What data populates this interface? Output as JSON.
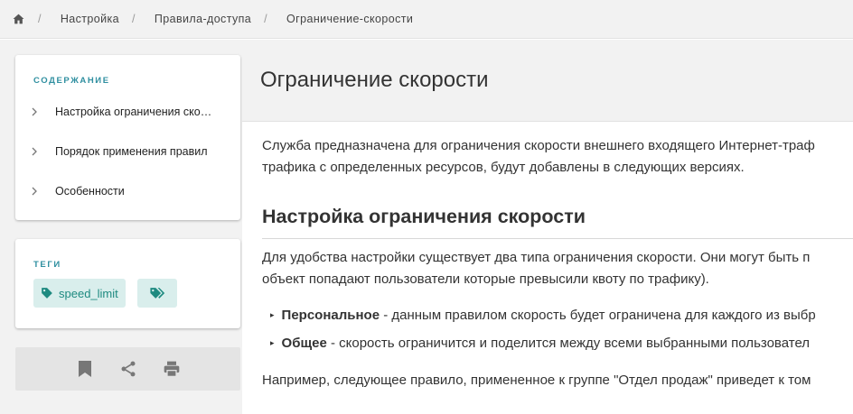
{
  "breadcrumb": {
    "home_icon": "home-icon",
    "items": [
      "Настройка",
      "Правила-доступа",
      "Ограничение-скорости"
    ],
    "separator": "/"
  },
  "toc": {
    "title": "СОДЕРЖАНИЕ",
    "items": [
      "Настройка ограничения скорости",
      "Порядок применения правил",
      "Особенности"
    ]
  },
  "tags": {
    "title": "ТЕГИ",
    "items": [
      {
        "label": "speed_limit",
        "icon": "tag-icon"
      }
    ],
    "more_icon": "tags-icon"
  },
  "actions": {
    "icons": [
      "bookmark-icon",
      "share-icon",
      "print-icon"
    ]
  },
  "page": {
    "title": "Ограничение скорости",
    "intro_line1": "Служба предназначена для ограничения скорости внешнего входящего Интернет-траф",
    "intro_line2": "трафика с определенных ресурсов, будут добавлены в следующих версиях.",
    "section_title": "Настройка ограничения скорости",
    "section_line1": "Для удобства настройки существует два типа ограничения скорости. Они могут быть п",
    "section_line2": "объект попадают пользователи которые превысили квоту по трафику).",
    "bullets": [
      {
        "bold": "Персональное",
        "text": " - данным правилом скорость будет ограничена для каждого из выбр"
      },
      {
        "bold": "Общее",
        "text": " - скорость ограничится и поделится между всеми выбранными пользовател"
      }
    ],
    "example_line": "Например, следующее правило, примененное к группе \"Отдел продаж\" приведет к том"
  },
  "colors": {
    "accent": "#2f8fa0",
    "tag_bg": "#d9eeec",
    "tag_text": "#1e8a80"
  }
}
